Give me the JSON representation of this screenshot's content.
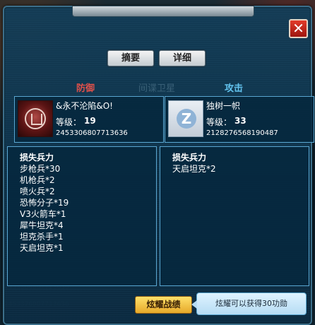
{
  "colors": {
    "defense": "#e0504a",
    "attack": "#62c3ee",
    "accent_button": "#f0c040"
  },
  "icons": {
    "close": "close-icon",
    "defender_avatar": "seal-avatar-icon",
    "attacker_avatar": "z-avatar-icon"
  },
  "tabs": {
    "summary": "摘要",
    "detail": "详细"
  },
  "sides": {
    "defense_label": "防御",
    "attack_label": "攻击",
    "center_ghost": "间谍卫星"
  },
  "defender": {
    "name": "&永不沦陷&O!",
    "level_label": "等级：",
    "level": "19",
    "id": "2453306807713636",
    "losses_header": "损失兵力",
    "losses": [
      "步枪兵*30",
      "机枪兵*2",
      "喷火兵*2",
      "恐怖分子*19",
      "V3火箭车*1",
      "犀牛坦克*4",
      "坦克杀手*1",
      "天启坦克*1"
    ]
  },
  "attacker": {
    "name": "独树一帜",
    "level_label": "等级：",
    "level": "33",
    "id": "2128276568190487",
    "losses_header": "损失兵力",
    "losses": [
      "天启坦克*2"
    ]
  },
  "footer": {
    "show_button": "炫耀战绩",
    "tip": "炫耀可以获得30功勋"
  }
}
